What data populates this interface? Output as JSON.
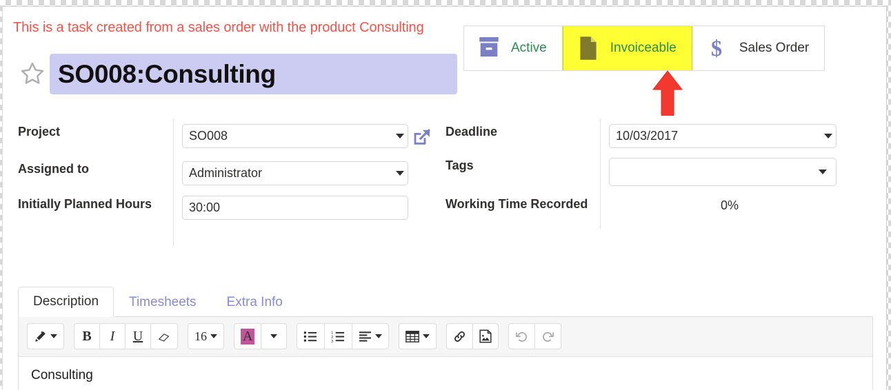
{
  "alert": {
    "text": "This is a task created from a sales order with the product Consulting",
    "color": "#f1544b"
  },
  "record": {
    "star_icon": "star-outline-icon",
    "title": "SO008:Consulting",
    "title_placeholder": "Task Title"
  },
  "statusbar": {
    "buttons": [
      {
        "label": "Active",
        "icon": "archive-box-icon",
        "highlighted": false,
        "label_color": "#2d8b4e"
      },
      {
        "label": "Invoiceable",
        "icon": "document-icon",
        "highlighted": true,
        "label_color": "#2d8b4e",
        "background": "#ffff33"
      },
      {
        "label": "Sales Order",
        "icon": "dollar-sign-icon",
        "highlighted": false,
        "label_color": "#31302f"
      }
    ]
  },
  "annotation": {
    "arrow_icon": "red-up-arrow-icon",
    "color": "#f3382f",
    "points_at": "Invoiceable"
  },
  "form": {
    "left": [
      {
        "label": "Project",
        "value": "SO008",
        "type": "dropdown",
        "has_external_link": true
      },
      {
        "label": "Assigned to",
        "value": "Administrator",
        "type": "dropdown"
      },
      {
        "label": "Initially Planned Hours",
        "value": "30:00",
        "type": "text"
      }
    ],
    "right": [
      {
        "label": "Deadline",
        "value": "10/03/2017",
        "type": "dropdown"
      },
      {
        "label": "Tags",
        "value": "",
        "type": "dropdown",
        "placeholder": ""
      },
      {
        "label": "Working Time Recorded",
        "value": "0%",
        "type": "readonly"
      }
    ],
    "external_link_icon": "external-link-icon"
  },
  "notebook": {
    "tabs": [
      {
        "label": "Description",
        "active": true
      },
      {
        "label": "Timesheets",
        "active": false
      },
      {
        "label": "Extra Info",
        "active": false
      }
    ]
  },
  "editor": {
    "toolbar": [
      {
        "icon": "magic-wand-icon",
        "caret": true,
        "label": ""
      },
      {
        "icon": "bold-icon",
        "caret": false,
        "label": "B"
      },
      {
        "icon": "italic-icon",
        "caret": false,
        "label": "I"
      },
      {
        "icon": "underline-icon",
        "caret": false,
        "label": "U"
      },
      {
        "icon": "eraser-icon",
        "caret": false,
        "label": ""
      },
      {
        "icon": "font-size-icon",
        "caret": true,
        "label": "16"
      },
      {
        "icon": "text-highlight-icon",
        "caret": false,
        "label": "A"
      },
      {
        "icon": "color-dropdown-icon",
        "caret": true,
        "label": ""
      },
      {
        "icon": "unordered-list-icon",
        "caret": false,
        "label": ""
      },
      {
        "icon": "ordered-list-icon",
        "caret": false,
        "label": ""
      },
      {
        "icon": "align-left-icon",
        "caret": true,
        "label": ""
      },
      {
        "icon": "table-icon",
        "caret": true,
        "label": ""
      },
      {
        "icon": "link-icon",
        "caret": false,
        "label": ""
      },
      {
        "icon": "insert-image-icon",
        "caret": false,
        "label": ""
      },
      {
        "icon": "undo-icon",
        "caret": false,
        "label": ""
      },
      {
        "icon": "redo-icon",
        "caret": false,
        "label": ""
      }
    ],
    "font_size": "16",
    "highlight_color": "#c0559c",
    "content": "Consulting"
  }
}
